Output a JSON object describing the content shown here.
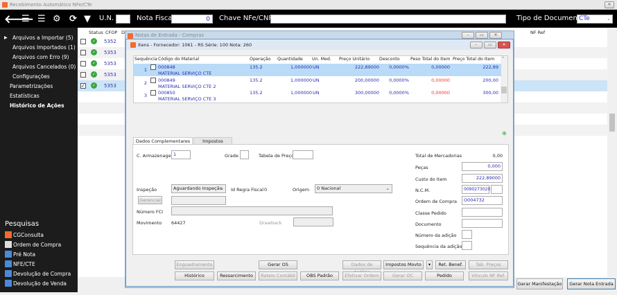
{
  "app": {
    "title": "Recebimento Automático NFe/CTe",
    "close_icon": "close-icon"
  },
  "toolbar": {
    "un_label": "U.N.",
    "un_value": "",
    "nota_label": "Nota Fiscal",
    "nota_value": "0",
    "chave_label": "Chave NFe/CNPJ",
    "chave_value": "",
    "tipo_label": "Tipo de Documento",
    "tipo_value": "CTe"
  },
  "sidebar": {
    "items": [
      {
        "label": "Arquivos a Importar (5)"
      },
      {
        "label": "Arquivos Importados (1)"
      },
      {
        "label": "Arquivos com Erro (9)"
      },
      {
        "label": "Arquivos Cancelados (0)"
      },
      {
        "label": "Configurações"
      },
      {
        "label": "Parametrizações"
      },
      {
        "label": "Estatísticas"
      },
      {
        "label": "Histórico de Ações"
      }
    ],
    "pesquisas_title": "Pesquisas",
    "pesquisas": [
      {
        "label": "CGConsulta"
      },
      {
        "label": "Ordem de Compra"
      },
      {
        "label": "Pré Nota"
      },
      {
        "label": "NFE/CTE"
      },
      {
        "label": "Devolução de Compra"
      },
      {
        "label": "Devolução de Venda"
      }
    ]
  },
  "background_grid": {
    "headers": [
      "Status",
      "CFOP",
      "D",
      "erado",
      "NF Ref"
    ],
    "rows": [
      {
        "checked": false,
        "cfop": "5352"
      },
      {
        "checked": false,
        "cfop": "5353"
      },
      {
        "checked": false,
        "cfop": "5353"
      },
      {
        "checked": false,
        "cfop": "5353"
      },
      {
        "checked": true,
        "cfop": "5353"
      }
    ]
  },
  "outer_window": {
    "title": "Notas de Entrada - Compras"
  },
  "items_window": {
    "title": "Itens - Fornecedor: 1061 - RS Série: 100  Nota: 260",
    "headers": [
      "Sequência",
      "Código do Material",
      "Operação",
      "Quantidade",
      "Un. Med.",
      "Preço Unitário",
      "Desconto",
      "Peso Total do Item",
      "Preço Total do Item"
    ],
    "rows": [
      {
        "seq": "1",
        "code": "000848",
        "desc": "MATERIAL SERVIÇO CTE",
        "op": "135.2",
        "qty": "1,000000",
        "un": "UN",
        "price": "222,89000",
        "disc": "0,0000%",
        "weight": "0,00000",
        "total": "222,89"
      },
      {
        "seq": "2",
        "code": "000849",
        "desc": "MATERIAL SERVIÇO CTE 2",
        "op": "135.2",
        "qty": "1,000000",
        "un": "UN",
        "price": "200,00000",
        "disc": "0,0000%",
        "weight": "0,00000",
        "total": "200,00"
      },
      {
        "seq": "3",
        "code": "000850",
        "desc": "MATERIAL SERVIÇO CTE 3",
        "op": "135.2",
        "qty": "1,000000",
        "un": "UN",
        "price": "300,00000",
        "disc": "0,0000%",
        "weight": "0,00000",
        "total": "300,00"
      }
    ]
  },
  "tabs": [
    "Dados Complementares",
    "Impostos"
  ],
  "form": {
    "armazenagem_label": "C. Armazenagem",
    "armazenagem_value": "1",
    "grade_label": "Grade",
    "tabela_label": "Tabela de Preço",
    "inspecao_label": "Inspeção",
    "inspecao_value": "Aguardando Inspeção",
    "regra_label": "Id Regra Fiscal",
    "regra_value": "0",
    "origem_label": "Origem",
    "origem_value": "0 Nacional",
    "gerencial_label": "Gerencial",
    "fci_label": "Número FCI",
    "movimento_label": "Movimento",
    "movimento_value": "64427",
    "drawback_label": "Drawback",
    "total_label": "Total de Mercadorias",
    "total_value": "0,00",
    "pecas_label": "Peças",
    "pecas_value": "0,000",
    "custo_label": "Custo do Item",
    "custo_value": "222,89000",
    "ncm_label": "N.C.M.",
    "ncm_value": "0090273020",
    "ordem_label": "Ordem de Compra",
    "ordem_value": "O004732",
    "classe_label": "Classe Pedido",
    "documento_label": "Documento",
    "num_adicao_label": "Número da adição",
    "seq_adicao_label": "Sequência da adição"
  },
  "buttons_row1": [
    "Enguadramento",
    "Gerar OS",
    "Dados de Análise",
    "Impostos Movto",
    "Ret. Benef.",
    "Tab. Preços"
  ],
  "buttons_row2": [
    "Histórico",
    "Ressarcimento",
    "Rateio Contábil",
    "OBS Padrão",
    "Efetivar Ordem",
    "Gerar OC",
    "Pedido",
    "Vínculo NF Ref."
  ],
  "main_buttons": {
    "manifestacao": "Gerar Manifestação",
    "nota_entrada": "Gerar Nota Entrada"
  }
}
